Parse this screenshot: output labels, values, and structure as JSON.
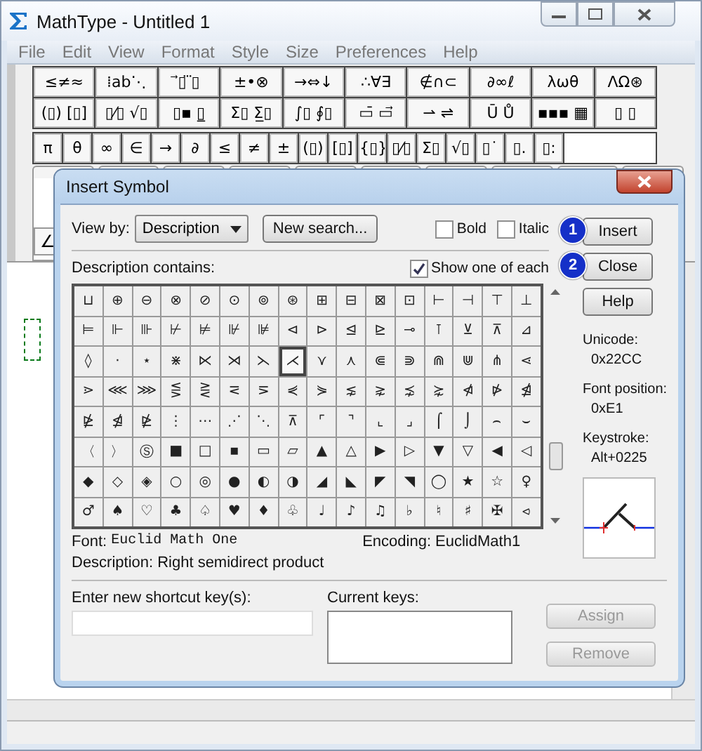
{
  "window": {
    "title": "MathType - Untitled 1"
  },
  "menu": [
    "File",
    "Edit",
    "View",
    "Format",
    "Style",
    "Size",
    "Preferences",
    "Help"
  ],
  "palette_rows": [
    [
      "≤≠≈",
      "⁞ab⋱",
      "⃗▯ ⃛▯",
      "±•⊗",
      "→⇔↓",
      "∴∀∃",
      "∉∩⊂",
      "∂∞ℓ",
      "λωθ",
      "ΛΩ⊛"
    ],
    [
      "(▯) [▯]",
      "▯⁄▯ √▯",
      "▯▪ ▯̲",
      "Σ▯ Σ̲▯",
      "∫▯ ∮▯",
      "▭̄ ▭⃗",
      "⇀ ⇌",
      "Ū Ů",
      "▪▪▪ ▦",
      "▯ ▯"
    ]
  ],
  "small_palette": [
    "π",
    "θ",
    "∞",
    "∈",
    "→",
    "∂",
    "≤",
    "≠",
    "±",
    "(▯)",
    "[▯]",
    "{▯}",
    "▯⁄▯",
    "Σ▯",
    "√▯",
    "▯˙",
    "▯.",
    "▯:"
  ],
  "side_buttons": [
    "∠"
  ],
  "dialog": {
    "title": "Insert Symbol",
    "view_by_label": "View by:",
    "view_by": "Description",
    "new_search": "New search...",
    "bold": {
      "label": "Bold",
      "checked": false
    },
    "italic": {
      "label": "Italic",
      "checked": false
    },
    "description_label": "Description contains:",
    "show_one": {
      "label": "Show one of each",
      "checked": true
    },
    "symbols": [
      [
        {
          "s": "⊔",
          "selected": false
        },
        {
          "s": "⊕",
          "selected": false
        },
        {
          "s": "⊖",
          "selected": false
        },
        {
          "s": "⊗",
          "selected": false
        },
        {
          "s": "⊘",
          "selected": false
        },
        {
          "s": "⊙",
          "selected": false
        },
        {
          "s": "⊚",
          "selected": false
        },
        {
          "s": "⊛",
          "selected": false
        },
        {
          "s": "⊞",
          "selected": false
        },
        {
          "s": "⊟",
          "selected": false
        },
        {
          "s": "⊠",
          "selected": false
        },
        {
          "s": "⊡",
          "selected": false
        },
        {
          "s": "⊢",
          "selected": false
        },
        {
          "s": "⊣",
          "selected": false
        },
        {
          "s": "⊤",
          "selected": false
        },
        {
          "s": "⊥",
          "selected": false
        }
      ],
      [
        {
          "s": "⊨",
          "selected": false
        },
        {
          "s": "⊩",
          "selected": false
        },
        {
          "s": "⊪",
          "selected": false
        },
        {
          "s": "⊬",
          "selected": false
        },
        {
          "s": "⊭",
          "selected": false
        },
        {
          "s": "⊮",
          "selected": false
        },
        {
          "s": "⊯",
          "selected": false
        },
        {
          "s": "⊲",
          "selected": false
        },
        {
          "s": "⊳",
          "selected": false
        },
        {
          "s": "⊴",
          "selected": false
        },
        {
          "s": "⊵",
          "selected": false
        },
        {
          "s": "⊸",
          "selected": false
        },
        {
          "s": "⊺",
          "selected": false
        },
        {
          "s": "⊻",
          "selected": false
        },
        {
          "s": "⊼",
          "selected": false
        },
        {
          "s": "⊿",
          "selected": false
        }
      ],
      [
        {
          "s": "◊",
          "selected": false
        },
        {
          "s": "·",
          "selected": false
        },
        {
          "s": "⋆",
          "selected": false
        },
        {
          "s": "⋇",
          "selected": false
        },
        {
          "s": "⋉",
          "selected": false
        },
        {
          "s": "⋊",
          "selected": false
        },
        {
          "s": "⋋",
          "selected": false
        },
        {
          "s": "⋌",
          "selected": true
        },
        {
          "s": "⋎",
          "selected": false
        },
        {
          "s": "⋏",
          "selected": false
        },
        {
          "s": "⋐",
          "selected": false
        },
        {
          "s": "⋑",
          "selected": false
        },
        {
          "s": "⋒",
          "selected": false
        },
        {
          "s": "⋓",
          "selected": false
        },
        {
          "s": "⋔",
          "selected": false
        },
        {
          "s": "⋖",
          "selected": false
        }
      ],
      [
        {
          "s": "⋗",
          "selected": false
        },
        {
          "s": "⋘",
          "selected": false
        },
        {
          "s": "⋙",
          "selected": false
        },
        {
          "s": "⋚",
          "selected": false
        },
        {
          "s": "⋛",
          "selected": false
        },
        {
          "s": "⋜",
          "selected": false
        },
        {
          "s": "⋝",
          "selected": false
        },
        {
          "s": "⋞",
          "selected": false
        },
        {
          "s": "⋟",
          "selected": false
        },
        {
          "s": "⋦",
          "selected": false
        },
        {
          "s": "⋧",
          "selected": false
        },
        {
          "s": "⋨",
          "selected": false
        },
        {
          "s": "⋩",
          "selected": false
        },
        {
          "s": "⋪",
          "selected": false
        },
        {
          "s": "⋫",
          "selected": false
        },
        {
          "s": "⋬",
          "selected": false
        }
      ],
      [
        {
          "s": "⋭",
          "selected": false
        },
        {
          "s": "⋬",
          "selected": false
        },
        {
          "s": "⋭",
          "selected": false
        },
        {
          "s": "⋮",
          "selected": false
        },
        {
          "s": "⋯",
          "selected": false
        },
        {
          "s": "⋰",
          "selected": false
        },
        {
          "s": "⋱",
          "selected": false
        },
        {
          "s": "⊼",
          "selected": false
        },
        {
          "s": "⌜",
          "selected": false
        },
        {
          "s": "⌝",
          "selected": false
        },
        {
          "s": "⌞",
          "selected": false
        },
        {
          "s": "⌟",
          "selected": false
        },
        {
          "s": "⌠",
          "selected": false
        },
        {
          "s": "⌡",
          "selected": false
        },
        {
          "s": "⌢",
          "selected": false
        },
        {
          "s": "⌣",
          "selected": false
        }
      ],
      [
        {
          "s": "〈",
          "selected": false
        },
        {
          "s": "〉",
          "selected": false
        },
        {
          "s": "Ⓢ",
          "selected": false
        },
        {
          "s": "■",
          "selected": false
        },
        {
          "s": "□",
          "selected": false
        },
        {
          "s": "▪",
          "selected": false
        },
        {
          "s": "▭",
          "selected": false
        },
        {
          "s": "▱",
          "selected": false
        },
        {
          "s": "▲",
          "selected": false
        },
        {
          "s": "△",
          "selected": false
        },
        {
          "s": "▶",
          "selected": false
        },
        {
          "s": "▷",
          "selected": false
        },
        {
          "s": "▼",
          "selected": false
        },
        {
          "s": "▽",
          "selected": false
        },
        {
          "s": "◀",
          "selected": false
        },
        {
          "s": "◁",
          "selected": false
        }
      ],
      [
        {
          "s": "◆",
          "selected": false
        },
        {
          "s": "◇",
          "selected": false
        },
        {
          "s": "◈",
          "selected": false
        },
        {
          "s": "○",
          "selected": false
        },
        {
          "s": "◎",
          "selected": false
        },
        {
          "s": "●",
          "selected": false
        },
        {
          "s": "◐",
          "selected": false
        },
        {
          "s": "◑",
          "selected": false
        },
        {
          "s": "◢",
          "selected": false
        },
        {
          "s": "◣",
          "selected": false
        },
        {
          "s": "◤",
          "selected": false
        },
        {
          "s": "◥",
          "selected": false
        },
        {
          "s": "◯",
          "selected": false
        },
        {
          "s": "★",
          "selected": false
        },
        {
          "s": "☆",
          "selected": false
        },
        {
          "s": "♀",
          "selected": false
        }
      ],
      [
        {
          "s": "♂",
          "selected": false
        },
        {
          "s": "♠",
          "selected": false
        },
        {
          "s": "♡",
          "selected": false
        },
        {
          "s": "♣",
          "selected": false
        },
        {
          "s": "♤",
          "selected": false
        },
        {
          "s": "♥",
          "selected": false
        },
        {
          "s": "♦",
          "selected": false
        },
        {
          "s": "♧",
          "selected": false
        },
        {
          "s": "♩",
          "selected": false
        },
        {
          "s": "♪",
          "selected": false
        },
        {
          "s": "♫",
          "selected": false
        },
        {
          "s": "♭",
          "selected": false
        },
        {
          "s": "♮",
          "selected": false
        },
        {
          "s": "♯",
          "selected": false
        },
        {
          "s": "✠",
          "selected": false
        },
        {
          "s": "⪦",
          "selected": false
        }
      ]
    ],
    "buttons": [
      {
        "label": "Insert",
        "badge": "1"
      },
      {
        "label": "Close",
        "badge": "2"
      },
      {
        "label": "Help"
      }
    ],
    "info": [
      {
        "label": "Unicode:",
        "value": "0x22CC"
      },
      {
        "label": "Font position:",
        "value": "0xE1"
      },
      {
        "label": "Keystroke:",
        "value": "Alt+0225"
      }
    ],
    "font_label": "Font:",
    "font": "Euclid Math One",
    "encoding_label": "Encoding:",
    "encoding": "EuclidMath1",
    "description_label_2": "Description:",
    "description": "Right semidirect product",
    "shortcut_label": "Enter new shortcut key(s):",
    "current_keys_label": "Current keys:",
    "key_buttons": [
      {
        "label": "Assign",
        "disabled": true
      },
      {
        "label": "Remove",
        "disabled": true
      }
    ]
  }
}
